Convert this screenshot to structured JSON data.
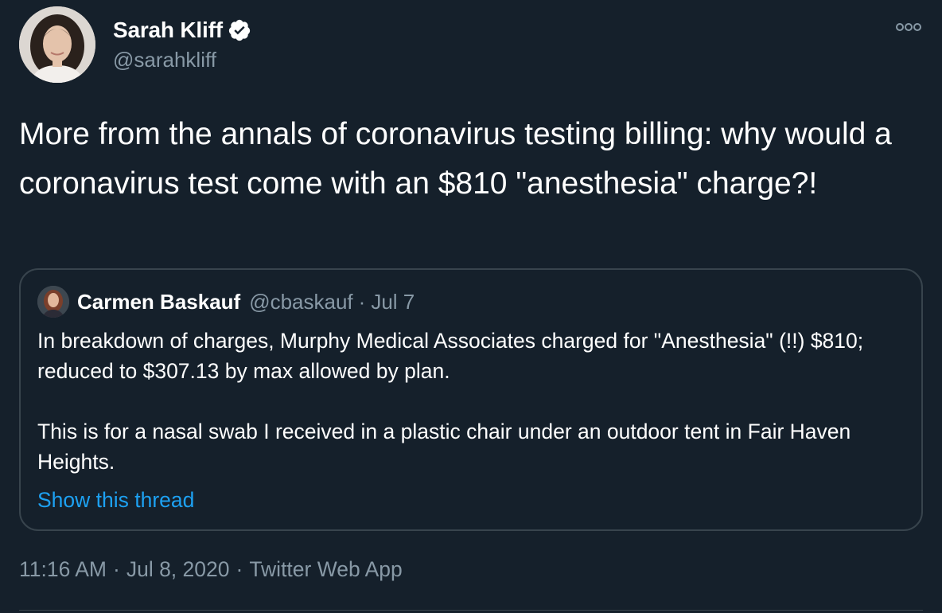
{
  "tweet": {
    "author": {
      "name": "Sarah Kliff",
      "handle": "@sarahkliff",
      "verified_icon": "verified-badge-icon"
    },
    "text": "More from the annals of coronavirus testing billing: why would a coronavirus test come with an $810 \"anesthesia\" charge?!",
    "more_icon": "more-options-icon",
    "quoted": {
      "name": "Carmen Baskauf",
      "handle": "@cbaskauf",
      "separator": "·",
      "date": "Jul 7",
      "text": "In breakdown of charges, Murphy Medical Associates charged for \"Anesthesia\" (!!) $810; reduced to $307.13 by max allowed by plan.\n\nThis is for a nasal swab I received in a plastic chair under an outdoor tent in Fair Haven Heights.",
      "show_thread": "Show this thread"
    },
    "meta": {
      "time": "11:16 AM",
      "separator": "·",
      "date": "Jul 8, 2020",
      "source": "Twitter Web App"
    }
  },
  "colors": {
    "background": "#15202b",
    "text_primary": "#ffffff",
    "text_secondary": "#8899a6",
    "link": "#1da1f2",
    "border": "#38444d"
  }
}
